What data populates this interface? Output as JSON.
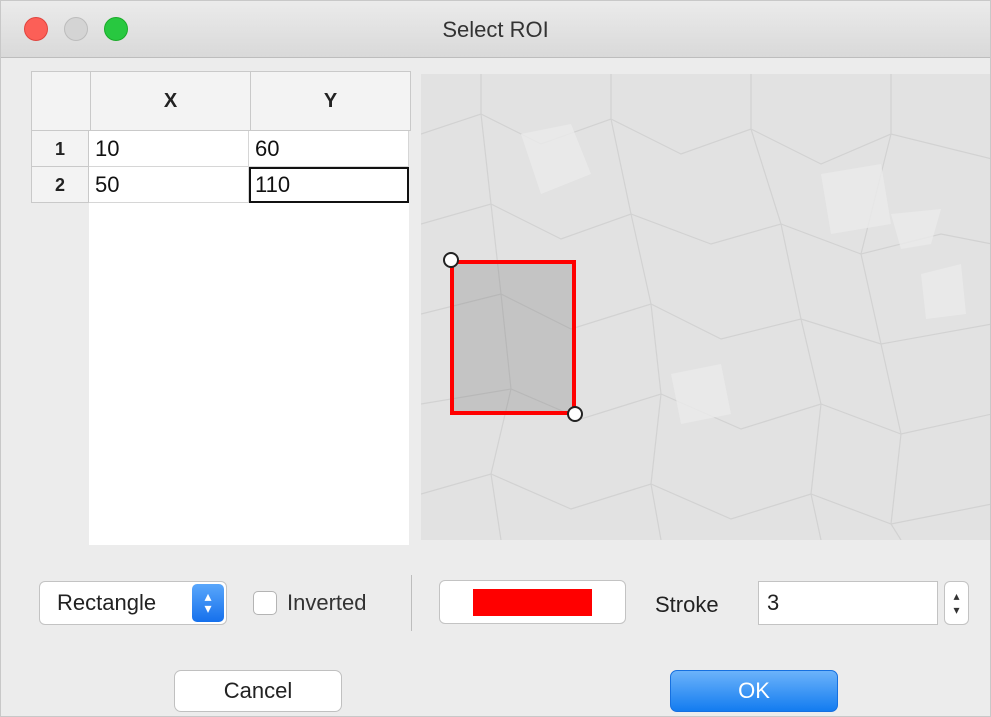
{
  "window": {
    "title": "Select ROI"
  },
  "table": {
    "columns": [
      "X",
      "Y"
    ],
    "rows": [
      {
        "index": "1",
        "x": "10",
        "y": "60"
      },
      {
        "index": "2",
        "x": "50",
        "y": "110"
      }
    ]
  },
  "controls": {
    "shape": "Rectangle",
    "inverted_label": "Inverted",
    "inverted_checked": false,
    "color": "#ff0000",
    "stroke_label": "Stroke",
    "stroke_value": "3"
  },
  "buttons": {
    "cancel": "Cancel",
    "ok": "OK"
  }
}
